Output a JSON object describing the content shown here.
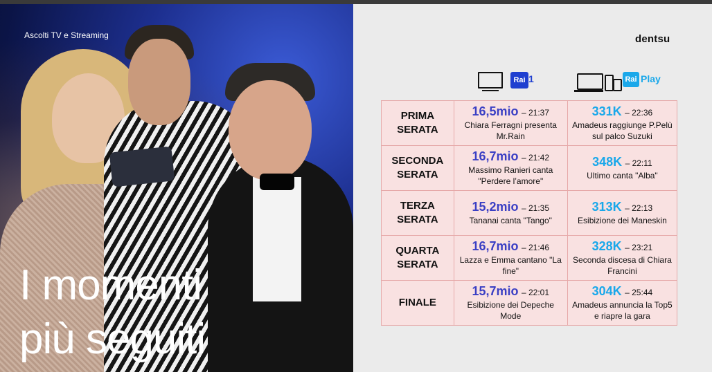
{
  "left": {
    "subtitle": "Ascolti TV e Streaming",
    "headline_line1": "I momenti",
    "headline_line2": "più seguiti"
  },
  "brand": "dentsu",
  "logos": {
    "rai1_text": "Rai",
    "rai1_num": "1",
    "raiplay_text": "Rai",
    "raiplay_word": "Play"
  },
  "colors": {
    "tv_value": "#3a3fc4",
    "play_value": "#1aa8ea",
    "cell_bg": "#f9e1e1",
    "cell_border": "#e6a9a9"
  },
  "rows": [
    {
      "night_line1": "PRIMA",
      "night_line2": "SERATA",
      "tv_value": "16,5mio",
      "tv_time": "– 21:37",
      "tv_desc": "Chiara Ferragni presenta Mr.Rain",
      "play_value": "331K",
      "play_time": "– 22:36",
      "play_desc": "Amadeus raggiunge P.Pelù sul palco Suzuki"
    },
    {
      "night_line1": "SECONDA",
      "night_line2": "SERATA",
      "tv_value": "16,7mio",
      "tv_time": "– 21:42",
      "tv_desc": "Massimo Ranieri canta \"Perdere l’amore\"",
      "play_value": "348K",
      "play_time": "– 22:11",
      "play_desc": "Ultimo canta \"Alba\""
    },
    {
      "night_line1": "TERZA",
      "night_line2": "SERATA",
      "tv_value": "15,2mio",
      "tv_time": "– 21:35",
      "tv_desc": "Tananai canta \"Tango\"",
      "play_value": "313K",
      "play_time": "– 22:13",
      "play_desc": "Esibizione dei Maneskin"
    },
    {
      "night_line1": "QUARTA",
      "night_line2": "SERATA",
      "tv_value": "16,7mio",
      "tv_time": "– 21:46",
      "tv_desc": "Lazza e Emma cantano \"La fine\"",
      "play_value": "328K",
      "play_time": "– 23:21",
      "play_desc": "Seconda discesa di Chiara Francini"
    },
    {
      "night_line1": "FINALE",
      "night_line2": "",
      "tv_value": "15,7mio",
      "tv_time": "– 22:01",
      "tv_desc": "Esibizione dei Depeche Mode",
      "play_value": "304K",
      "play_time": "– 25:44",
      "play_desc": "Amadeus annuncia la Top5 e riapre la gara"
    }
  ]
}
